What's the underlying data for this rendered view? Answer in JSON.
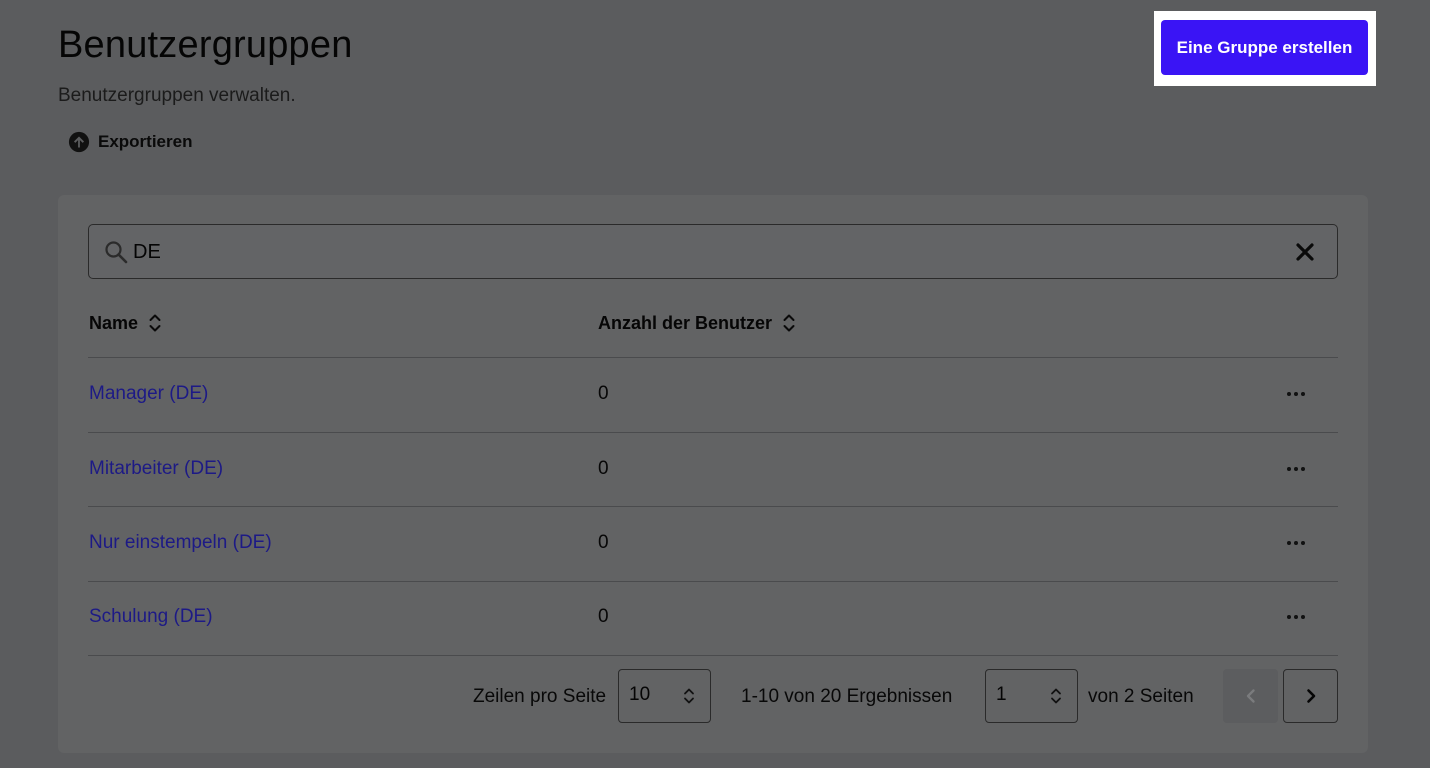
{
  "header": {
    "title": "Benutzergruppen",
    "subtitle": "Benutzergruppen verwalten.",
    "export_label": "Exportieren",
    "create_button_label": "Eine Gruppe erstellen"
  },
  "search": {
    "value": "DE"
  },
  "table": {
    "columns": [
      "Name",
      "Anzahl der Benutzer"
    ],
    "rows": [
      {
        "name": "Manager (DE)",
        "count": "0"
      },
      {
        "name": "Mitarbeiter (DE)",
        "count": "0"
      },
      {
        "name": "Nur einstempeln (DE)",
        "count": "0"
      },
      {
        "name": "Schulung (DE)",
        "count": "0"
      }
    ]
  },
  "pagination": {
    "rows_per_page_label": "Zeilen pro Seite",
    "rows_per_page_value": "10",
    "results_text": "1-10 von 20 Ergebnissen",
    "page_value": "1",
    "pages_text": "von 2 Seiten"
  },
  "colors": {
    "overlay_background": "#5b5c5e",
    "primary_button": "#3a14f5",
    "link": "#1d1a86"
  },
  "icons": {
    "export": "upload-circle-icon",
    "search": "search-icon",
    "clear": "close-icon",
    "sort": "sort-icon",
    "row_menu": "more-horizontal-icon",
    "select": "chevron-updown-icon",
    "prev": "chevron-left-icon",
    "next": "chevron-right-icon"
  }
}
